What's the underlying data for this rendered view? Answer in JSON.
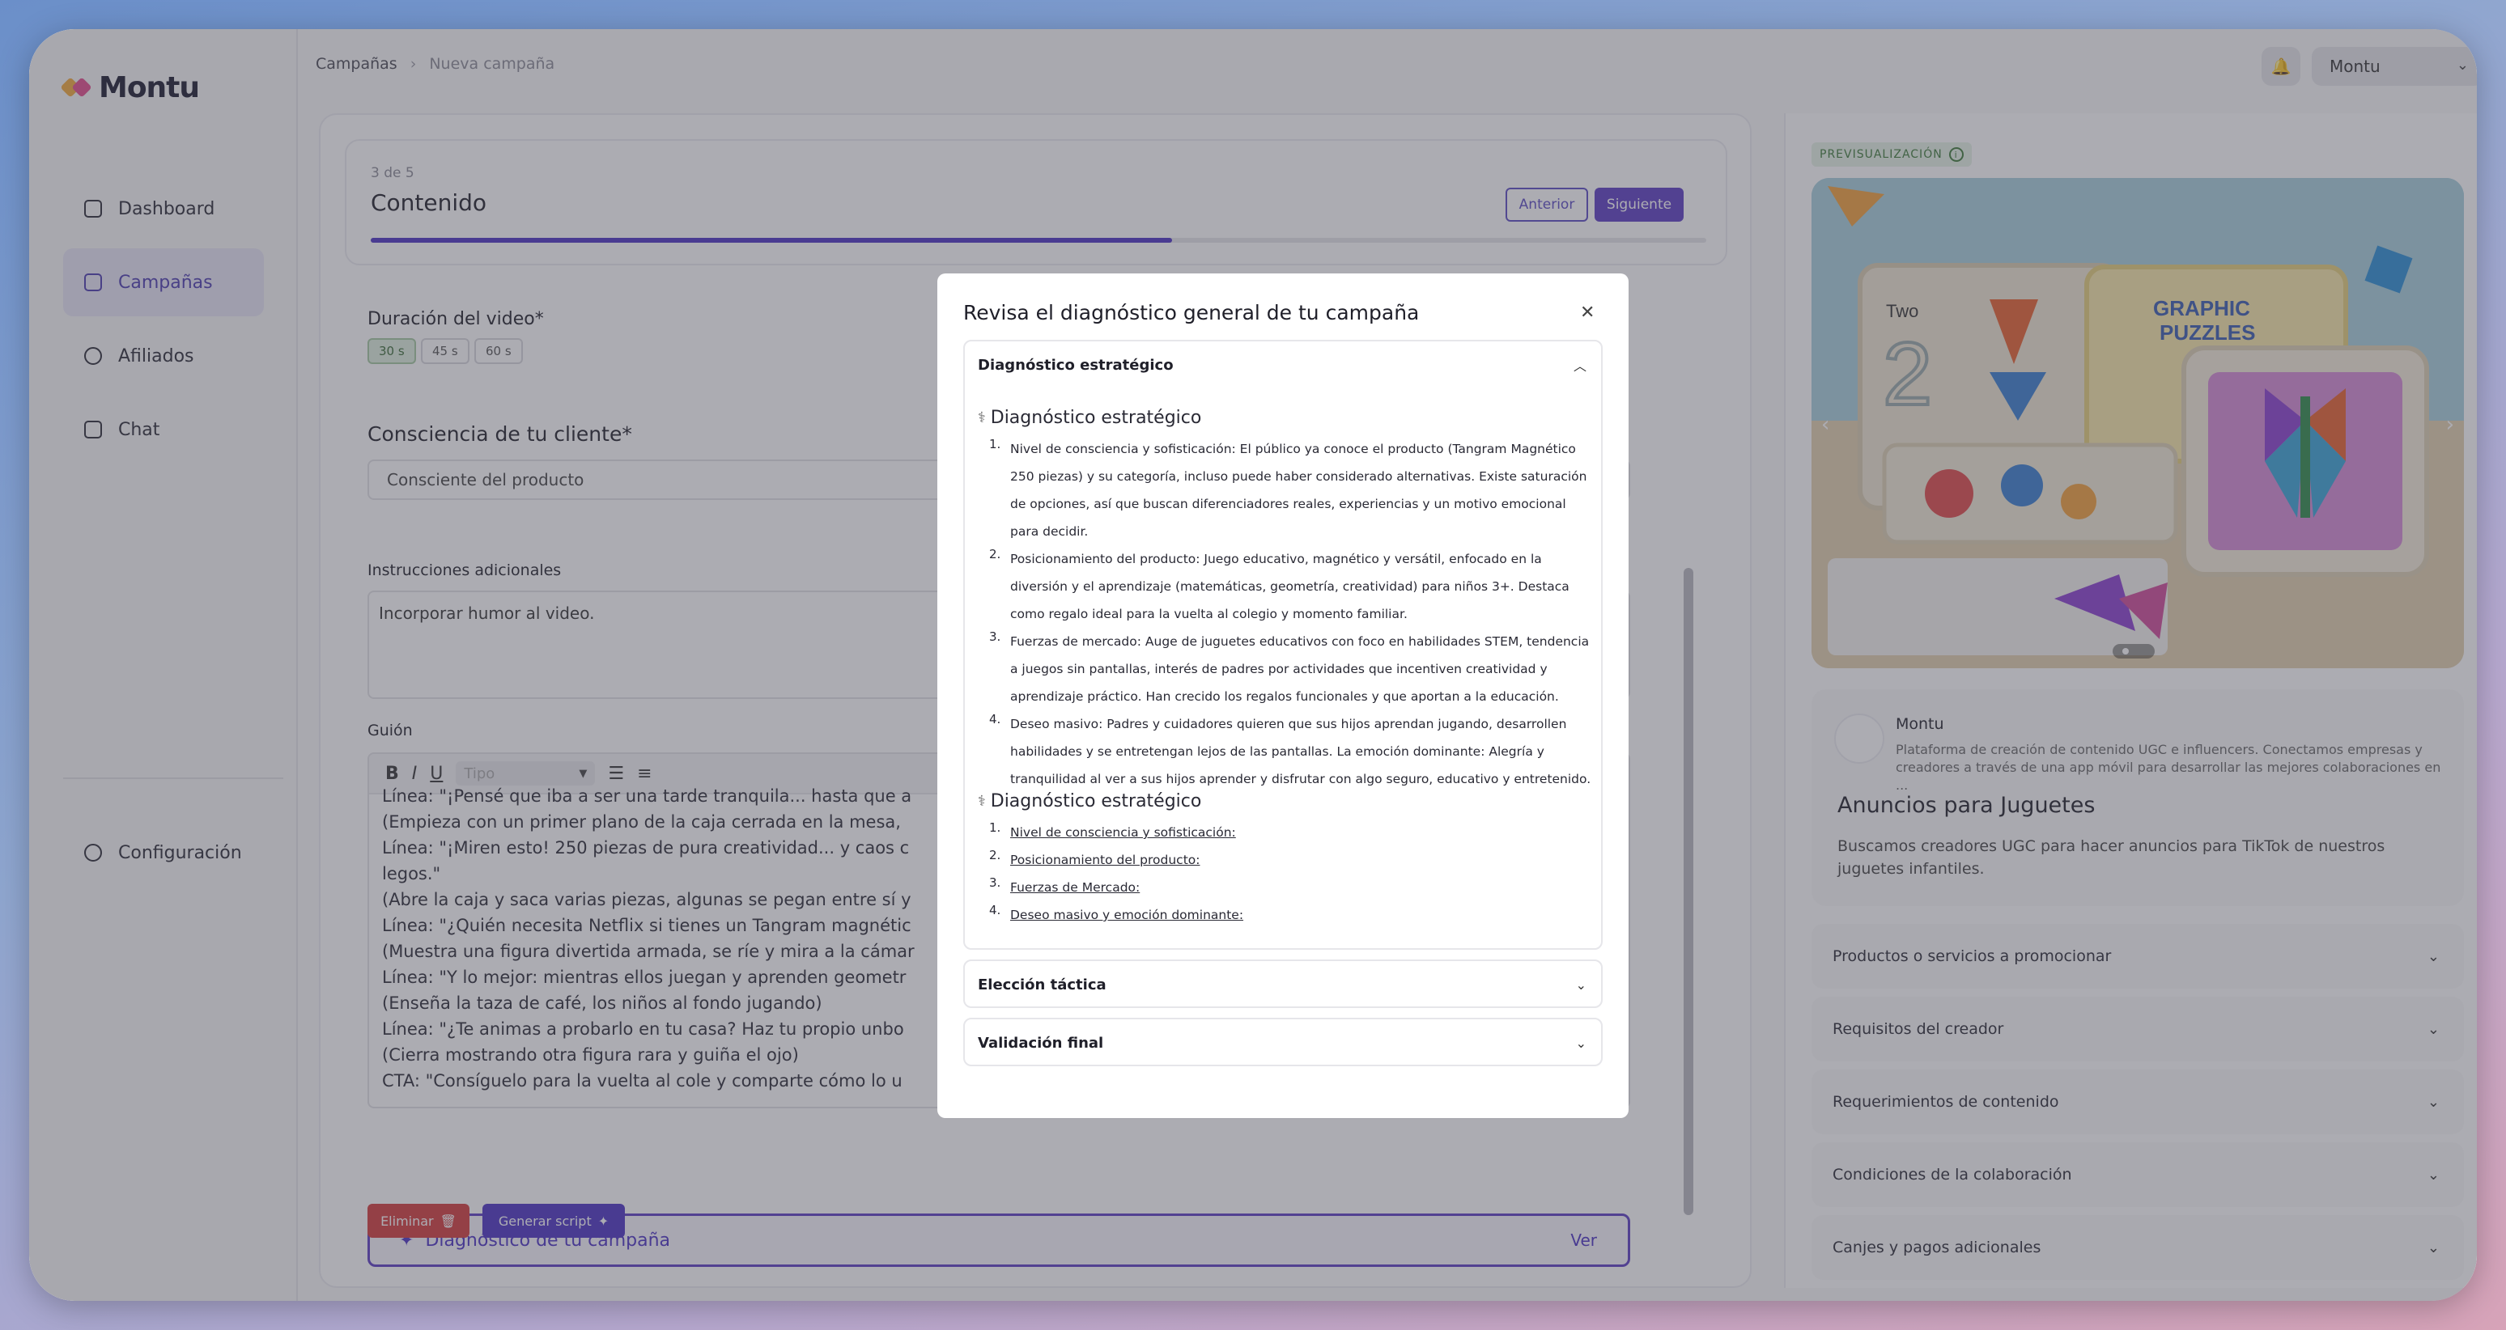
{
  "app": {
    "logo": "Montu",
    "brand_colors": {
      "accent": "#5b3cc4",
      "danger": "#d33b3b",
      "success": "#3e7a3a"
    }
  },
  "sidebar": {
    "items": [
      {
        "label": "Dashboard",
        "icon": "home-icon"
      },
      {
        "label": "Campañas",
        "icon": "briefcase-icon",
        "active": true
      },
      {
        "label": "Afiliados",
        "icon": "users-icon"
      },
      {
        "label": "Chat",
        "icon": "inbox-icon"
      }
    ],
    "config_label": "Configuración"
  },
  "topbar": {
    "breadcrumb": [
      "Campañas",
      "Nueva campaña"
    ],
    "user": "Montu"
  },
  "step": {
    "count": "3 de 5",
    "title": "Contenido",
    "prev_label": "Anterior",
    "next_label": "Siguiente",
    "progress": 0.6
  },
  "form": {
    "duration_label": "Duración del video*",
    "durations": [
      "30 s",
      "45 s",
      "60 s"
    ],
    "duration_selected": "30 s",
    "awareness_label": "Consciencia de tu cliente*",
    "awareness_value": "Consciente del producto",
    "instructions_label": "Instrucciones adicionales",
    "instructions_value": "Incorporar humor al video.",
    "script_label": "Guión",
    "toolbar_type_placeholder": "Tipo",
    "script_lines": [
      "Línea: \"¡Pensé que iba a ser una tarde tranquila... hasta que a",
      "(Empieza con un primer plano de la caja cerrada en la mesa,",
      "Línea: \"¡Miren esto! 250 piezas de pura creatividad... y caos c",
      "legos.\"",
      "(Abre la caja y saca varias piezas, algunas se pegan entre sí y",
      "Línea: \"¿Quién necesita Netflix si tienes un Tangram magnétic",
      "(Muestra una figura divertida armada, se ríe y mira a la cámar",
      "Línea: \"Y lo mejor: mientras ellos juegan y aprenden geometr",
      "(Enseña la taza de café, los niños al fondo jugando)",
      "Línea: \"¿Te animas a probarlo en tu casa? Haz tu propio unbo",
      "(Cierra mostrando otra figura rara y guiña el ojo)",
      "CTA: \"Consíguelo para la vuelta al cole y comparte cómo lo u"
    ],
    "diagnostic_button": "Diagnóstico de tu campaña",
    "diagnostic_view": "Ver",
    "delete_label": "Eliminar",
    "generate_label": "Generar script"
  },
  "preview": {
    "badge": "PREVISUALIZACIÓN",
    "brand_name": "Montu",
    "brand_desc": "Plataforma de creación de contenido UGC e influencers. Conectamos empresas y creadores a través de una app móvil para desarrollar las mejores colaboraciones en ...",
    "ad_title": "Anuncios para Juguetes",
    "ad_desc": "Buscamos creadores UGC para hacer anuncios para TikTok de nuestros juguetes infantiles.",
    "sections": [
      "Productos o servicios a promocionar",
      "Requisitos del creador",
      "Requerimientos de contenido",
      "Condiciones de la colaboración",
      "Canjes y pagos adicionales"
    ],
    "image_labels": {
      "two": "Two",
      "puzzles": "GRAPHIC PUZZLES"
    }
  },
  "modal": {
    "title": "Revisa el diagnóstico general de tu campaña",
    "sections": [
      {
        "title": "Diagnóstico estratégico",
        "expanded": true
      },
      {
        "title": "Elección táctica",
        "expanded": false
      },
      {
        "title": "Validación final",
        "expanded": false
      }
    ],
    "strategic_title": "Diagnóstico estratégico",
    "strategic_items": [
      "Nivel de consciencia y sofisticación: El público ya conoce el producto (Tangram Magnético 250 piezas) y su categoría, incluso puede haber considerado alternativas. Existe saturación de opciones, así que buscan diferenciadores reales, experiencias y un motivo emocional para decidir.",
      "Posicionamiento del producto: Juego educativo, magnético y versátil, enfocado en la diversión y el aprendizaje (matemáticas, geometría, creatividad) para niños 3+. Destaca como regalo ideal para la vuelta al colegio y momento familiar.",
      "Fuerzas de mercado: Auge de juguetes educativos con foco en habilidades STEM, tendencia a juegos sin pantallas, interés de padres por actividades que incentiven creatividad y aprendizaje práctico. Han crecido los regalos funcionales y que aportan a la educación.",
      "Deseo masivo: Padres y cuidadores quieren que sus hijos aprendan jugando, desarrollen habilidades y se entretengan lejos de las pantallas. La emoción dominante: Alegría y tranquilidad al ver a sus hijos aprender y disfrutar con algo seguro, educativo y entretenido."
    ],
    "strategic_title_2": "Diagnóstico estratégico",
    "link_items": [
      "Nivel de consciencia y sofisticación:",
      "Posicionamiento del producto:",
      "Fuerzas de Mercado:",
      "Deseo masivo y emoción dominante:"
    ]
  }
}
